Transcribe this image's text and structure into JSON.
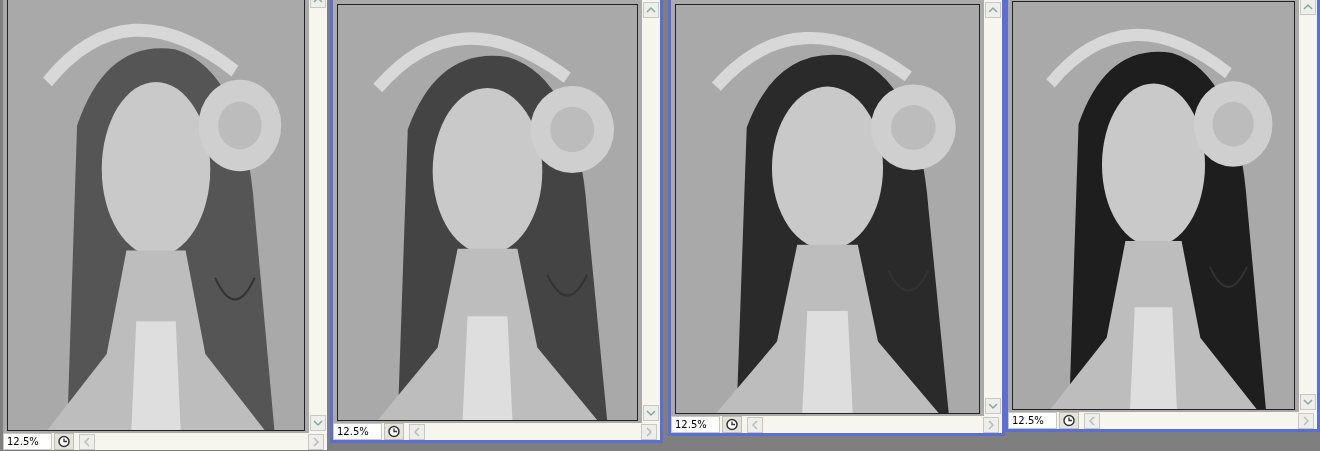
{
  "windows": [
    {
      "zoom": "12.5%"
    },
    {
      "zoom": "12.5%"
    },
    {
      "zoom": "12.5%"
    },
    {
      "zoom": "12.5%"
    }
  ]
}
